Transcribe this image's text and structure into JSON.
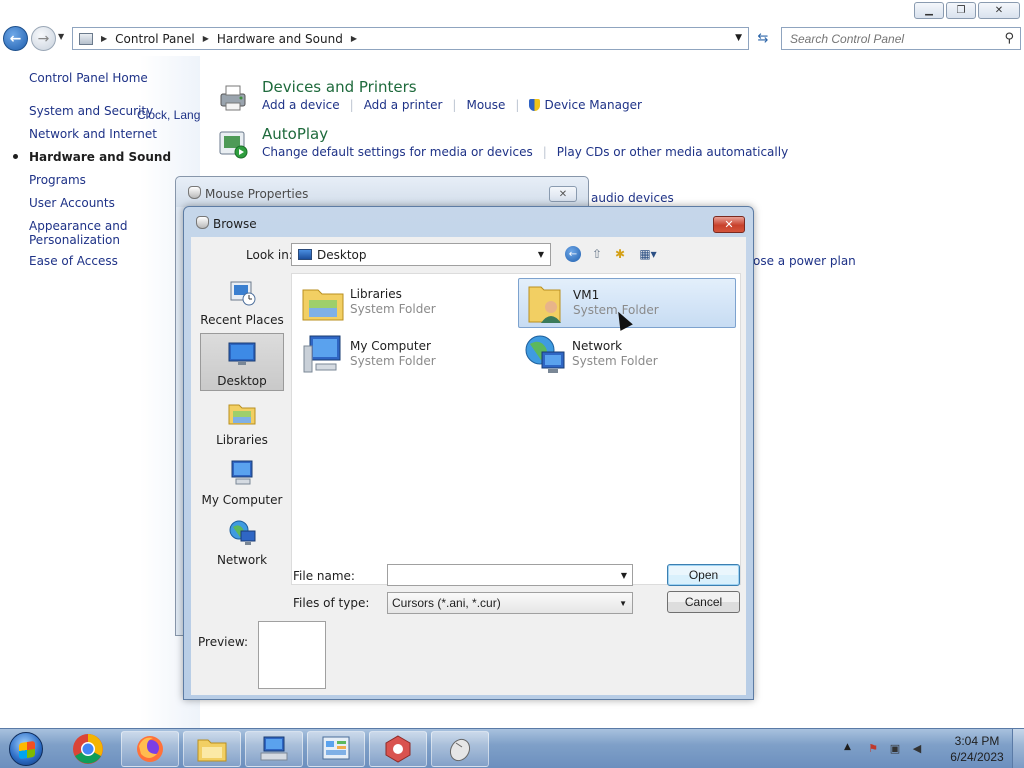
{
  "control_panel": {
    "address": {
      "crumbs": [
        "Control Panel",
        "Hardware and Sound"
      ]
    },
    "search_placeholder": "Search Control Panel",
    "left_pane": {
      "home": "Control Panel Home",
      "items": [
        "System and Security",
        "Network and Internet",
        "Hardware and Sound",
        "Programs",
        "User Accounts",
        "Appearance and Personalization",
        "Clock, Language, and Regio",
        "Ease of Access"
      ],
      "active_index": 2
    },
    "categories": [
      {
        "title": "Devices and Printers",
        "links": [
          "Add a device",
          "Add a printer",
          "Mouse",
          "Device Manager"
        ]
      },
      {
        "title": "AutoPlay",
        "links": [
          "Change default settings for media or devices",
          "Play CDs or other media automatically"
        ]
      }
    ],
    "partial_links": [
      "audio devices",
      "ose a power plan"
    ]
  },
  "mouse_properties": {
    "title": "Mouse Properties"
  },
  "browse_dialog": {
    "title": "Browse",
    "look_in_label": "Look in:",
    "look_in_value": "Desktop",
    "places": [
      "Recent Places",
      "Desktop",
      "Libraries",
      "My Computer",
      "Network"
    ],
    "selected_place": "Desktop",
    "items": [
      {
        "name": "Libraries",
        "type": "System Folder"
      },
      {
        "name": "VM1",
        "type": "System Folder"
      },
      {
        "name": "My Computer",
        "type": "System Folder"
      },
      {
        "name": "Network",
        "type": "System Folder"
      }
    ],
    "selected_item": "VM1",
    "file_name_label": "File name:",
    "file_name_value": "",
    "files_of_type_label": "Files of type:",
    "files_of_type_value": "Cursors (*.ani, *.cur)",
    "open_label": "Open",
    "cancel_label": "Cancel",
    "preview_label": "Preview:"
  },
  "taskbar": {
    "time": "3:04 PM",
    "date": "6/24/2023"
  }
}
